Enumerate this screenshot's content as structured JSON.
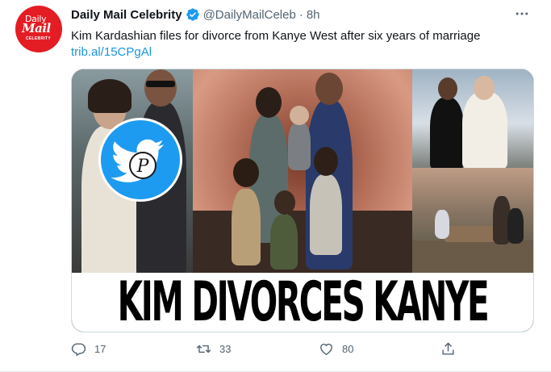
{
  "account": {
    "name": "Daily Mail Celebrity",
    "handle": "@DailyMailCeleb",
    "separator": "·",
    "time": "8h",
    "avatar": {
      "line1": "Daily",
      "line2": "Mail",
      "line3": "CELEBRITY"
    }
  },
  "tweet": {
    "text": "Kim Kardashian files for divorce from Kanye West after six years of marriage",
    "link": "trib.al/15CPgAl"
  },
  "media": {
    "headline": "KIM DIVORCES KANYE",
    "watermark_letter": "P"
  },
  "actions": {
    "replies": "17",
    "retweets": "33",
    "likes": "80"
  },
  "colors": {
    "brand_red": "#e41c24",
    "link_blue": "#1b95e0",
    "verified_blue": "#1d9bf0",
    "muted": "#536471"
  },
  "icons": {
    "more": "more-horizontal-icon",
    "verified": "verified-badge-icon",
    "reply": "reply-icon",
    "retweet": "retweet-icon",
    "like": "heart-icon",
    "share": "share-icon"
  }
}
